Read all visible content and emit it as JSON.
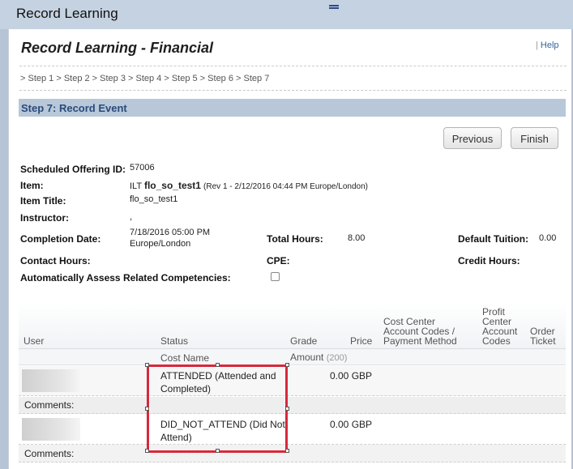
{
  "window": {
    "title": "Record Learning"
  },
  "page": {
    "title": "Record Learning - Financial",
    "help_sep": "|",
    "help": "Help",
    "breadcrumb": "> Step 1 > Step 2 > Step 3 > Step 4 > Step 5 > Step 6 > Step 7",
    "step_title": "Step 7: Record Event"
  },
  "buttons": {
    "previous": "Previous",
    "finish": "Finish"
  },
  "details": {
    "scheduled_offering_id_label": "Scheduled Offering ID:",
    "scheduled_offering_id": "57006",
    "item_label": "Item:",
    "item_prefix": "ILT",
    "item_name": "flo_so_test1",
    "item_rev": "(Rev 1 - 2/12/2016 04:44 PM Europe/London)",
    "item_title_label": "Item Title:",
    "item_title": "flo_so_test1",
    "instructor_label": "Instructor:",
    "instructor": ",",
    "completion_date_label": "Completion Date:",
    "completion_date_line1": "7/18/2016 05:00 PM",
    "completion_date_line2": "Europe/London",
    "total_hours_label": "Total Hours:",
    "total_hours": "8.00",
    "default_tuition_label": "Default Tuition:",
    "default_tuition": "0.00",
    "contact_hours_label": "Contact Hours:",
    "cpe_label": "CPE:",
    "credit_hours_label": "Credit Hours:",
    "auto_assess_label": "Automatically Assess Related Competencies:"
  },
  "grid": {
    "headers": {
      "user": "User",
      "status": "Status",
      "grade": "Grade",
      "price": "Price",
      "cost_center_l1": "Cost Center",
      "cost_center_l2": "Account Codes /",
      "cost_center_l3": "Payment Method",
      "profit_center_l1": "Profit",
      "profit_center_l2": "Center",
      "profit_center_l3": "Account",
      "profit_center_l4": "Codes",
      "order_l1": "Order",
      "order_l2": "Ticket"
    },
    "subheader": {
      "cost_name": "Cost Name",
      "amount": "Amount",
      "amount_count": "(200)"
    },
    "rows": [
      {
        "status": "ATTENDED (Attended and Completed)",
        "price": "0.00 GBP",
        "comments": "Comments:"
      },
      {
        "status": "DID_NOT_ATTEND (Did Not Attend)",
        "price": "0.00 GBP",
        "comments": "Comments:"
      }
    ]
  },
  "colors": {
    "highlight": "#d8283a",
    "step_header": "#b8c8d9",
    "title_bar": "#c5d2e1"
  }
}
